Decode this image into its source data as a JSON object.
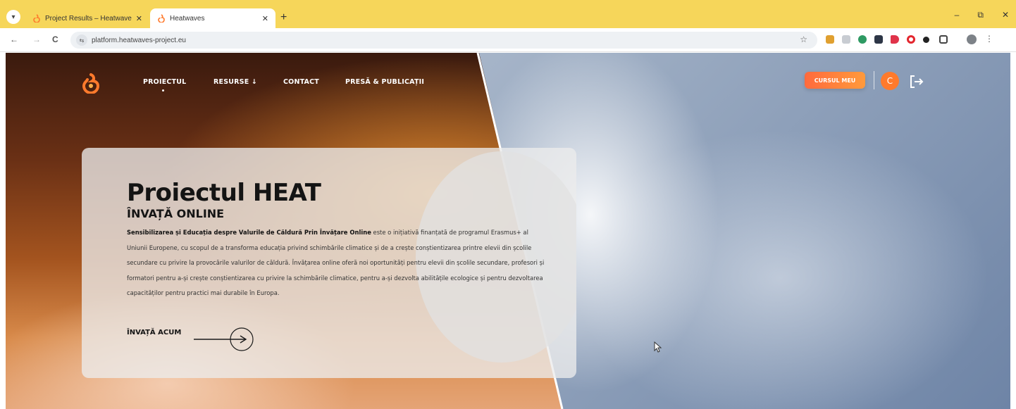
{
  "browser": {
    "tabs": [
      {
        "title": "Project Results – Heatwaves",
        "active": false
      },
      {
        "title": "Heatwaves",
        "active": true
      }
    ],
    "url": "platform.heatwaves-project.eu",
    "new_tab_symbol": "+",
    "window_controls": [
      "–",
      "⧉",
      "✕"
    ],
    "nav_symbols": {
      "back": "←",
      "forward": "→",
      "reload": "C"
    },
    "star_symbol": "☆",
    "tab_close_symbol": "✕",
    "search_tabs_symbol": "▾",
    "site_info_symbol": "⇆"
  },
  "site": {
    "nav": {
      "items": [
        "PROIECTUL",
        "RESURSE ↓",
        "CONTACT",
        "PRESĂ & PUBLICAȚII"
      ],
      "active_index": 0
    },
    "course_button": "CURSUL MEU",
    "avatar_initial": "C",
    "brand_color": "#ff7a2c"
  },
  "hero": {
    "title": "Proiectul HEAT",
    "subtitle": "ÎNVAȚĂ ONLINE",
    "intro_bold": "Sensibilizarea și Educația despre Valurile de Căldură Prin Învățare Online",
    "intro_rest": " este o inițiativă finanțată de programul Erasmus+ al Uniunii Europene, cu scopul de a transforma educația privind schimbările climatice și de a crește conștientizarea printre elevii din școlile secundare cu privire la provocările valurilor de căldură. Învățarea online oferă noi oportunități pentru elevii din școlile secundare, profesori și formatori pentru a-și crește conștientizarea cu privire la schimbările climatice, pentru a-și dezvolta abilitățile ecologice și pentru dezvoltarea capacităților pentru practici mai durabile în Europa.",
    "cta_label": "ÎNVAȚĂ ACUM"
  }
}
